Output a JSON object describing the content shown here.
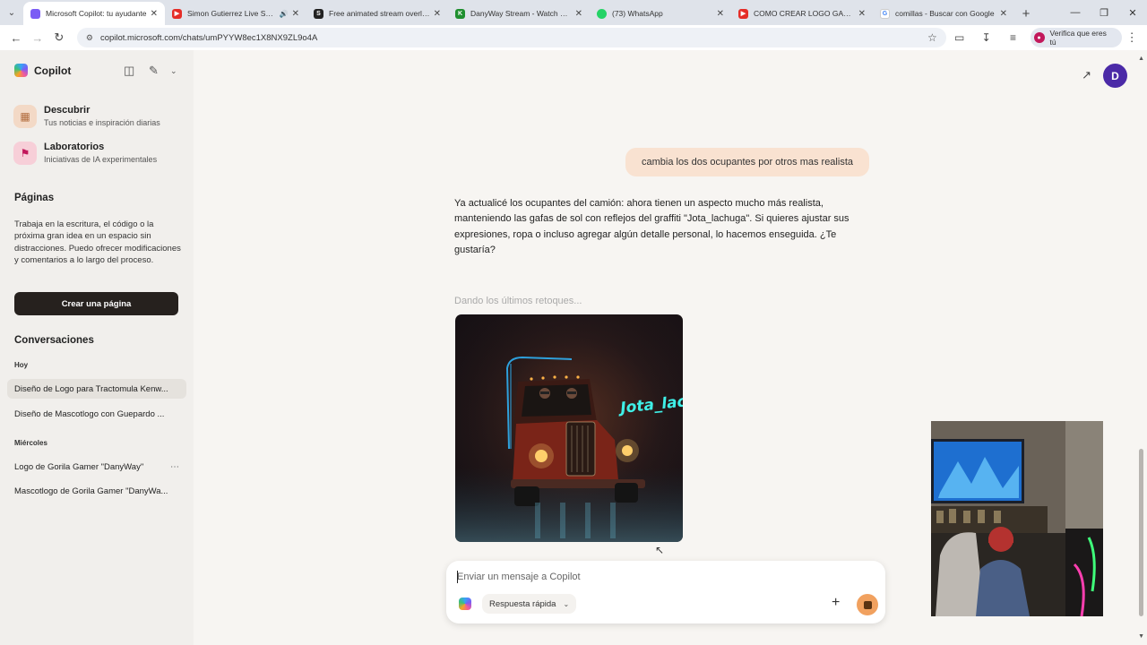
{
  "browser": {
    "tabs": [
      {
        "title": "Microsoft Copilot: tu ayudante",
        "active": true,
        "favicon_color": "#7b5cf5"
      },
      {
        "title": "Simon Gutierrez Live Set - Y",
        "favicon_color": "#e52d27",
        "muted_icon": "speaker-icon"
      },
      {
        "title": "Free animated stream overlays",
        "favicon_color": "#222222",
        "favicon_text": "S"
      },
      {
        "title": "DanyWay Stream - Watch Live",
        "favicon_color": "#1f8f2f",
        "favicon_text": "K"
      },
      {
        "title": "(73) WhatsApp",
        "favicon_color": "#25d366"
      },
      {
        "title": "COMO CREAR LOGO GAMER P",
        "favicon_color": "#e52d27"
      },
      {
        "title": "comillas - Buscar con Google",
        "favicon_color": "#4285f4",
        "favicon_text": "G"
      }
    ],
    "url": "copilot.microsoft.com/chats/umPYYW8ec1X8NX9ZL9o4A",
    "profile_chip": "Verifica que eres tú"
  },
  "sidebar": {
    "brand": "Copilot",
    "nav": [
      {
        "title": "Descubrir",
        "subtitle": "Tus noticias e inspiración diarias",
        "icon": "grid-icon",
        "color": "#f3d9c6"
      },
      {
        "title": "Laboratorios",
        "subtitle": "Iniciativas de IA experimentales",
        "icon": "flask-icon",
        "color": "#f7cfd8"
      }
    ],
    "pages_heading": "Páginas",
    "pages_desc": "Trabaja en la escritura, el código o la próxima gran idea en un espacio sin distracciones. Puedo ofrecer modificaciones y comentarios a lo largo del proceso.",
    "create_page": "Crear una página",
    "conversations_heading": "Conversaciones",
    "groups": [
      {
        "day": "Hoy",
        "items": [
          "Diseño de Logo para Tractomula Kenw...",
          "Diseño de Mascotlogo con Guepardo ..."
        ]
      },
      {
        "day": "Miércoles",
        "items": [
          "Logo de Gorila Gamer \"DanyWay\"",
          "Mascotlogo de Gorila Gamer \"DanyWa..."
        ]
      }
    ]
  },
  "header": {
    "avatar_initial": "D"
  },
  "chat": {
    "user_message": "cambia los dos ocupantes por otros mas realista",
    "assistant_message": "Ya actualicé los ocupantes del camión: ahora tienen un aspecto mucho más realista, manteniendo las gafas de sol con reflejos del graffiti \"Jota_lachuga\". Si quieres ajustar sus expresiones, ropa o incluso agregar algún detalle personal, lo hacemos enseguida. ¿Te gustaría?",
    "status": "Dando los últimos retoques...",
    "image_text": "Jota_lachuga"
  },
  "composer": {
    "placeholder": "Enviar un mensaje a Copilot",
    "mode": "Respuesta rápida"
  }
}
